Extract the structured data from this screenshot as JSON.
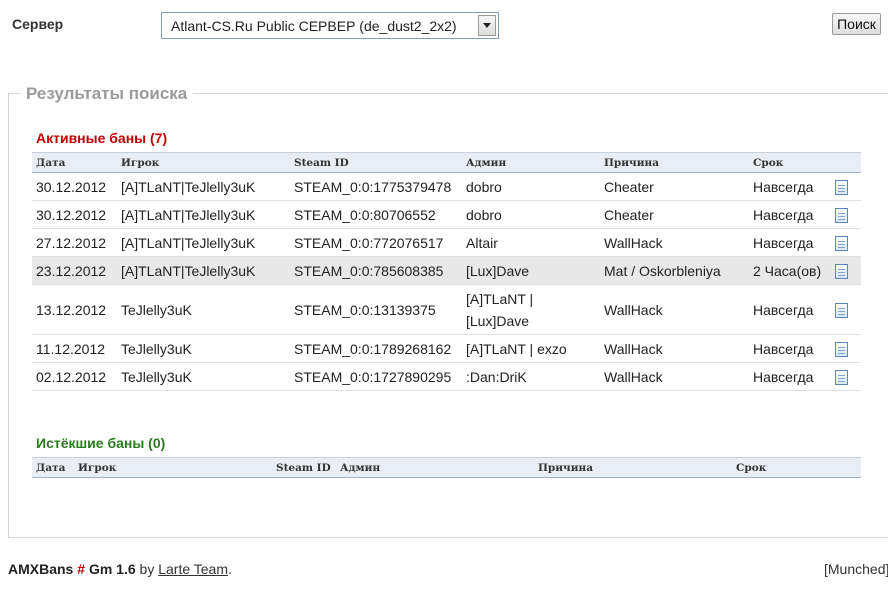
{
  "server": {
    "label": "Сервер",
    "selected": "Atlant-CS.Ru Public СЕРВЕР (de_dust2_2x2)",
    "button": "Поиск"
  },
  "results": {
    "legend": "Результаты поиска",
    "active_title": "Активные баны (7)",
    "expired_title": "Истёкшие баны (0)",
    "columns": {
      "date": "Дата",
      "player": "Игрок",
      "steam": "Steam ID",
      "admin": "Админ",
      "reason": "Причина",
      "length": "Срок"
    },
    "active": [
      {
        "date": "30.12.2012",
        "player": "[A]TLaNT|TeJlelly3uK",
        "steam": "STEAM_0:0:1775379478",
        "admin": "dobro",
        "reason": "Cheater",
        "length": "Навсегда",
        "icon": "details-icon"
      },
      {
        "date": "30.12.2012",
        "player": "[A]TLaNT|TeJlelly3uK",
        "steam": "STEAM_0:0:80706552",
        "admin": "dobro",
        "reason": "Cheater",
        "length": "Навсегда",
        "icon": "details-icon"
      },
      {
        "date": "27.12.2012",
        "player": "[A]TLaNT|TeJlelly3uK",
        "steam": "STEAM_0:0:772076517",
        "admin": "Altair",
        "reason": "WallHack",
        "length": "Навсегда",
        "icon": "details-icon"
      },
      {
        "date": "23.12.2012",
        "player": "[A]TLaNT|TeJlelly3uK",
        "steam": "STEAM_0:0:785608385",
        "admin": "[Lux]Dave",
        "reason": "Mat / Oskorbleniya",
        "length": "2 Часа(ов)",
        "icon": "details-icon"
      },
      {
        "date": "13.12.2012",
        "player": "TeJlelly3uK",
        "steam": "STEAM_0:0:13139375",
        "admin": "[A]TLaNT | [Lux]Dave",
        "reason": "WallHack",
        "length": "Навсегда",
        "icon": "details-icon"
      },
      {
        "date": "11.12.2012",
        "player": "TeJlelly3uK",
        "steam": "STEAM_0:0:1789268162",
        "admin": "[A]TLaNT | exzo",
        "reason": "WallHack",
        "length": "Навсегда",
        "icon": "details-icon"
      },
      {
        "date": "02.12.2012",
        "player": "TeJlelly3uK",
        "steam": "STEAM_0:0:1727890295",
        "admin": ":Dan:DriK",
        "reason": "WallHack",
        "length": "Навсегда",
        "icon": "details-icon"
      }
    ]
  },
  "footer": {
    "brand": "AMXBans",
    "hash": "#",
    "version": "Gm 1.6",
    "by": "by",
    "team": "Larte Team",
    "dot": ".",
    "right": "[Munched]"
  },
  "colors": {
    "active_title": "#c00000",
    "expired_title": "#2a7a1e",
    "legend": "#9a9a9a",
    "header_bg": "#e9eef6",
    "highlight_row": "#e8e8e8"
  }
}
